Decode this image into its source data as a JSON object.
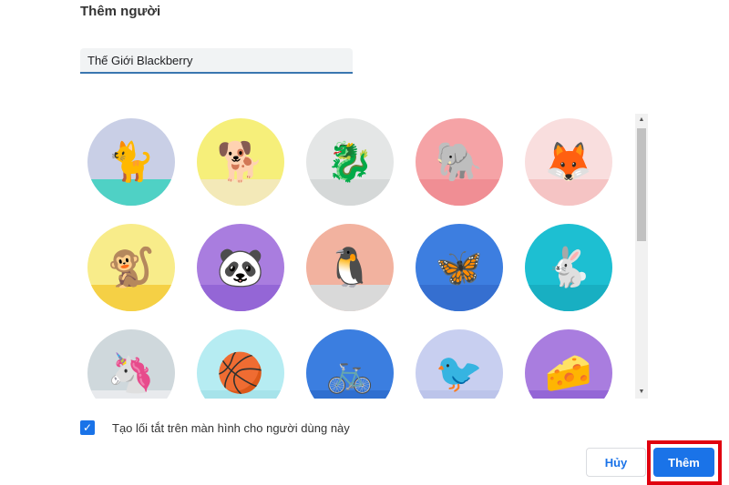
{
  "dialog": {
    "title": "Thêm người",
    "name_value": "Thế Giới Blackberry"
  },
  "avatars": [
    {
      "name": "cat",
      "bg": "#c9cfe6",
      "floor": "#4fd1c5",
      "sym": "🐈"
    },
    {
      "name": "corgi",
      "bg": "#f6ef7a",
      "floor": "#f3e9b8",
      "sym": "🐕"
    },
    {
      "name": "dragon",
      "bg": "#e4e6e6",
      "floor": "#d5d8d8",
      "sym": "🐉"
    },
    {
      "name": "elephant",
      "bg": "#f5a3a6",
      "floor": "#f08e94",
      "sym": "🐘"
    },
    {
      "name": "fox",
      "bg": "#f9dede",
      "floor": "#f5c4c4",
      "sym": "🦊"
    },
    {
      "name": "monkey",
      "bg": "#f8ec8a",
      "floor": "#f5d045",
      "sym": "🐒"
    },
    {
      "name": "panda",
      "bg": "#a97ddf",
      "floor": "#9466d6",
      "sym": "🐼"
    },
    {
      "name": "penguin",
      "bg": "#f2b29f",
      "floor": "#d9d9d9",
      "sym": "🐧"
    },
    {
      "name": "butterfly",
      "bg": "#3d7ee0",
      "floor": "#356fd0",
      "sym": "🦋"
    },
    {
      "name": "rabbit",
      "bg": "#1dbfd2",
      "floor": "#18afc2",
      "sym": "🐇"
    },
    {
      "name": "unicorn",
      "bg": "#cfd8dc",
      "floor": "#e8eaed",
      "sym": "🦄"
    },
    {
      "name": "basketball",
      "bg": "#b6ecf2",
      "floor": "#a6e3ea",
      "sym": "🏀"
    },
    {
      "name": "bicycle",
      "bg": "#3b7ee0",
      "floor": "#2f6fd0",
      "sym": "🚲"
    },
    {
      "name": "bird",
      "bg": "#c8cff0",
      "floor": "#bcc4ea",
      "sym": "🐦"
    },
    {
      "name": "cheese",
      "bg": "#a97ddf",
      "floor": "#9466d6",
      "sym": "🧀"
    }
  ],
  "shortcut": {
    "checked": true,
    "label": "Tạo lối tắt trên màn hình cho người dùng này"
  },
  "buttons": {
    "cancel": "Hủy",
    "add": "Thêm"
  },
  "colors": {
    "accent": "#1a73e8",
    "highlight": "#e0000f"
  }
}
